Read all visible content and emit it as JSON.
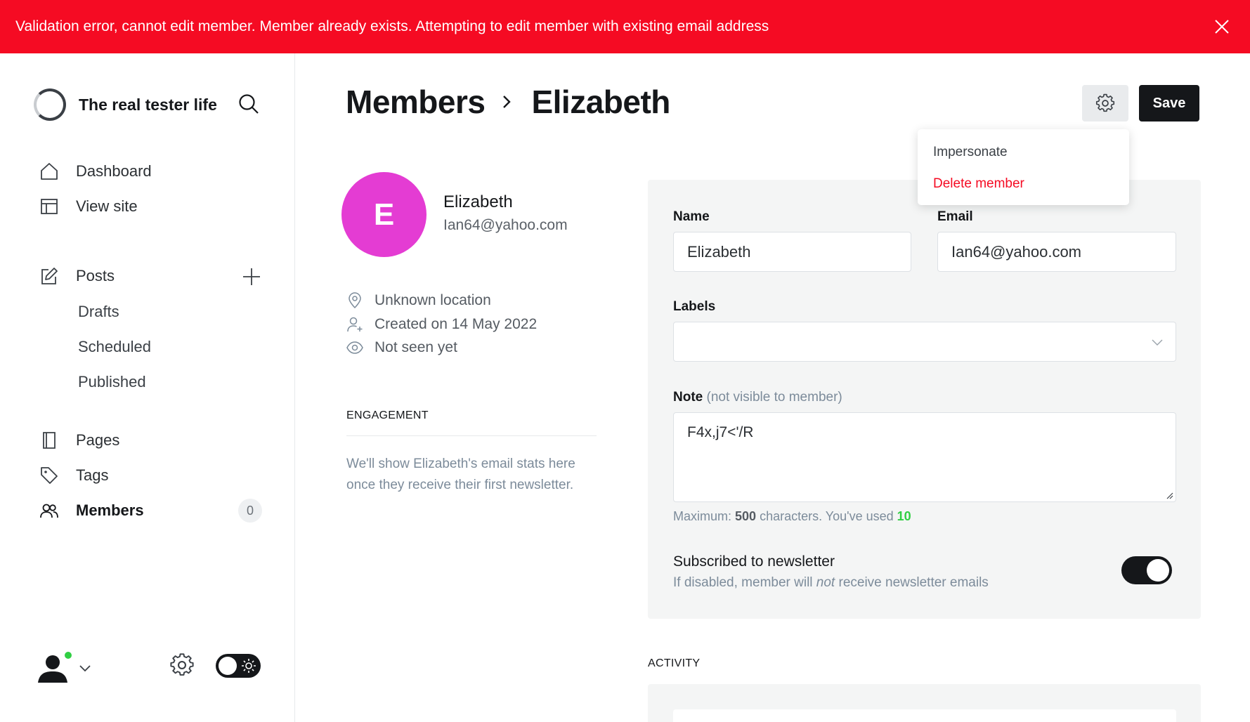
{
  "banner": {
    "message": "Validation error, cannot edit member. Member already exists. Attempting to edit member with existing email address",
    "color": "#f50b23"
  },
  "sidebar": {
    "site_name": "The real tester life",
    "nav": {
      "dashboard": "Dashboard",
      "view_site": "View site",
      "posts": "Posts",
      "drafts": "Drafts",
      "scheduled": "Scheduled",
      "published": "Published",
      "pages": "Pages",
      "tags": "Tags",
      "members": "Members",
      "members_count": "0"
    }
  },
  "header": {
    "breadcrumb_parent": "Members",
    "breadcrumb_current": "Elizabeth",
    "save_label": "Save",
    "menu": {
      "impersonate": "Impersonate",
      "delete": "Delete member"
    }
  },
  "member": {
    "initial": "E",
    "name": "Elizabeth",
    "email": "Ian64@yahoo.com",
    "location": "Unknown location",
    "created": "Created on 14 May 2022",
    "seen": "Not seen yet",
    "avatar_color": "#e43cd3",
    "engagement_title": "ENGAGEMENT",
    "engagement_text": "We'll show Elizabeth's email stats here once they receive their first newsletter."
  },
  "form": {
    "name_label": "Name",
    "name_value": "Elizabeth",
    "email_label": "Email",
    "email_value": "Ian64@yahoo.com",
    "labels_label": "Labels",
    "note_label": "Note",
    "note_sub": "(not visible to member)",
    "note_value": "F4x,j7<'/R",
    "char_prefix": "Maximum: ",
    "char_max": "500",
    "char_mid": " characters. You've used ",
    "char_used": "10",
    "subscribed_title": "Subscribed to newsletter",
    "subscribed_desc_1": "If disabled, member will ",
    "subscribed_desc_em": "not",
    "subscribed_desc_2": " receive newsletter emails",
    "subscribed": true
  },
  "activity": {
    "title": "ACTIVITY"
  }
}
